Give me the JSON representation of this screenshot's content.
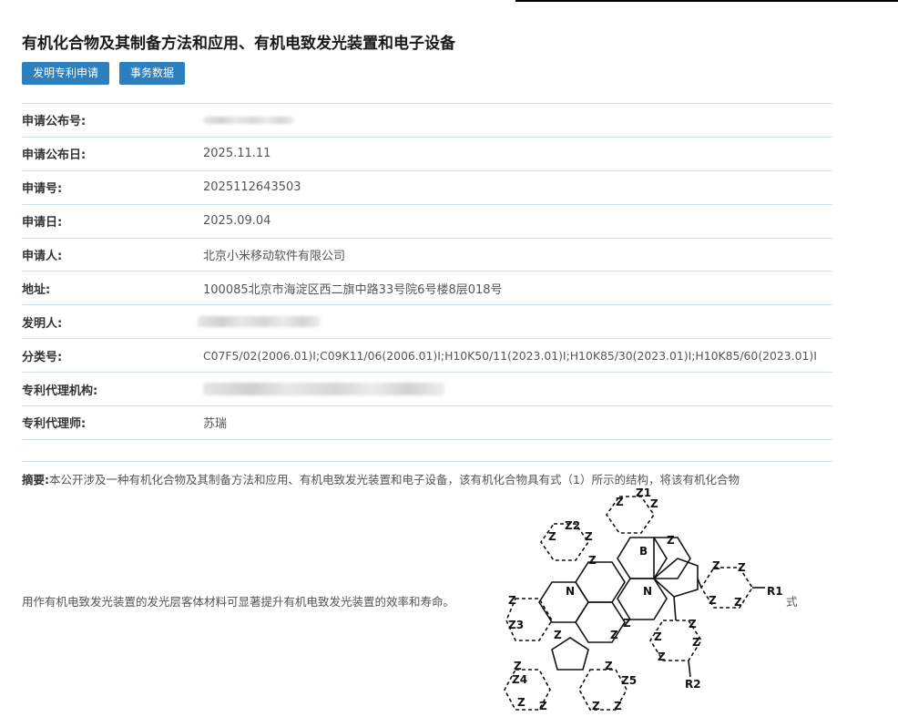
{
  "page": {
    "title": "有机化合物及其制备方法和应用、有机电致发光装置和电子设备"
  },
  "buttons": {
    "patent_application": "发明专利申请",
    "affairs_data": "事务数据"
  },
  "details": [
    {
      "label": "申请公布号:",
      "value": "",
      "redacted": true
    },
    {
      "label": "申请公布日:",
      "value": "2025.11.11"
    },
    {
      "label": "申请号:",
      "value": "2025112643503"
    },
    {
      "label": "申请日:",
      "value": "2025.09.04"
    },
    {
      "label": "申请人:",
      "value": "北京小米移动软件有限公司"
    },
    {
      "label": "地址:",
      "value": "100085北京市海淀区西二旗中路33号院6号楼8层018号"
    },
    {
      "label": "发明人:",
      "value": "",
      "redacted": true
    },
    {
      "label": "分类号:",
      "value": "C07F5/02(2006.01)I;C09K11/06(2006.01)I;H10K50/11(2023.01)I;H10K85/30(2023.01)I;H10K85/60(2023.01)I"
    },
    {
      "label": "专利代理机构:",
      "value": "",
      "redacted": true
    },
    {
      "label": "专利代理师:",
      "value": "苏瑞"
    }
  ],
  "abstract": {
    "label": "摘要:",
    "line1": "本公开涉及一种有机化合物及其制备方法和应用、有机电致发光装置和电子设备，该有机化合物具有式（1）所示的结构，将该有机化合物",
    "line2": "用作有机电致发光装置的发光层客体材料可显著提升有机电致发光装置的效率和寿命。",
    "formula_suffix": "式"
  },
  "formula_labels": {
    "boron": "B",
    "nitrogen": "N",
    "z": "Z",
    "r1": "R1",
    "r2": "R2",
    "z1": "Z1",
    "z2": "Z2",
    "z3": "Z3",
    "z4": "Z4",
    "z5": "Z5"
  }
}
